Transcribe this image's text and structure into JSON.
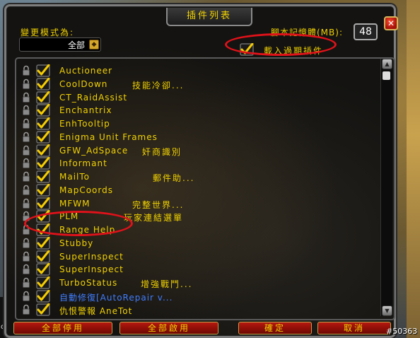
{
  "window": {
    "title": "插件列表",
    "close_symbol": "✕"
  },
  "header": {
    "mode_label": "變更模式為:",
    "mode_selected": "全部",
    "memory_label": "腳本記憶體(MB):",
    "memory_value": "48",
    "load_outdated_label": "載入過期插件",
    "load_outdated_checked": true
  },
  "addons": [
    {
      "name": "Auctioneer",
      "desc": "",
      "checked": true,
      "color": "#f1d200"
    },
    {
      "name": "CoolDown",
      "desc": "技能冷卻...",
      "checked": true,
      "color": "#f1d200"
    },
    {
      "name": "CT_RaidAssist",
      "desc": "",
      "checked": true,
      "color": "#f1d200"
    },
    {
      "name": "Enchantrix",
      "desc": "",
      "checked": true,
      "color": "#f1d200"
    },
    {
      "name": "EnhTooltip",
      "desc": "",
      "checked": true,
      "color": "#f1d200"
    },
    {
      "name": "Enigma Unit Frames",
      "desc": "",
      "checked": true,
      "color": "#f1d200"
    },
    {
      "name": "GFW_AdSpace",
      "desc": "奸商識別",
      "checked": true,
      "color": "#f1d200"
    },
    {
      "name": "Informant",
      "desc": "",
      "checked": true,
      "color": "#f1d200"
    },
    {
      "name": "MailTo",
      "desc": "郵件助...",
      "checked": true,
      "color": "#f1d200"
    },
    {
      "name": "MapCoords",
      "desc": "",
      "checked": true,
      "color": "#f1d200"
    },
    {
      "name": "MFWM",
      "desc": "完整世界...",
      "checked": true,
      "color": "#f1d200"
    },
    {
      "name": "PLM",
      "desc": "玩家連結選單",
      "checked": true,
      "color": "#f1d200"
    },
    {
      "name": "Range Help",
      "desc": "",
      "checked": true,
      "color": "#f1d200"
    },
    {
      "name": "Stubby",
      "desc": "",
      "checked": true,
      "color": "#f1d200"
    },
    {
      "name": "SuperInspect",
      "desc": "",
      "checked": true,
      "color": "#f1d200"
    },
    {
      "name": "SuperInspect",
      "desc": "",
      "checked": true,
      "color": "#f1d200"
    },
    {
      "name": "TurboStatus",
      "desc": "增強戰鬥...",
      "checked": true,
      "color": "#f1d200"
    },
    {
      "name": "自動修復[AutoRepair v...",
      "desc": "",
      "checked": true,
      "color": "#3f7dff"
    },
    {
      "name": "仇恨警報 AneTot",
      "desc": "",
      "checked": true,
      "color": "#f1d200"
    }
  ],
  "buttons": {
    "disable_all": "全部停用",
    "enable_all": "全部啟用",
    "okay": "確定",
    "cancel": "取消"
  },
  "overlay": {
    "image_id": "#50363",
    "left_edge_text": "ot"
  },
  "colors": {
    "text_gold": "#f1d200",
    "text_blue": "#3f7dff",
    "highlight_red": "#e0121a",
    "button_red": "#b5180f"
  }
}
